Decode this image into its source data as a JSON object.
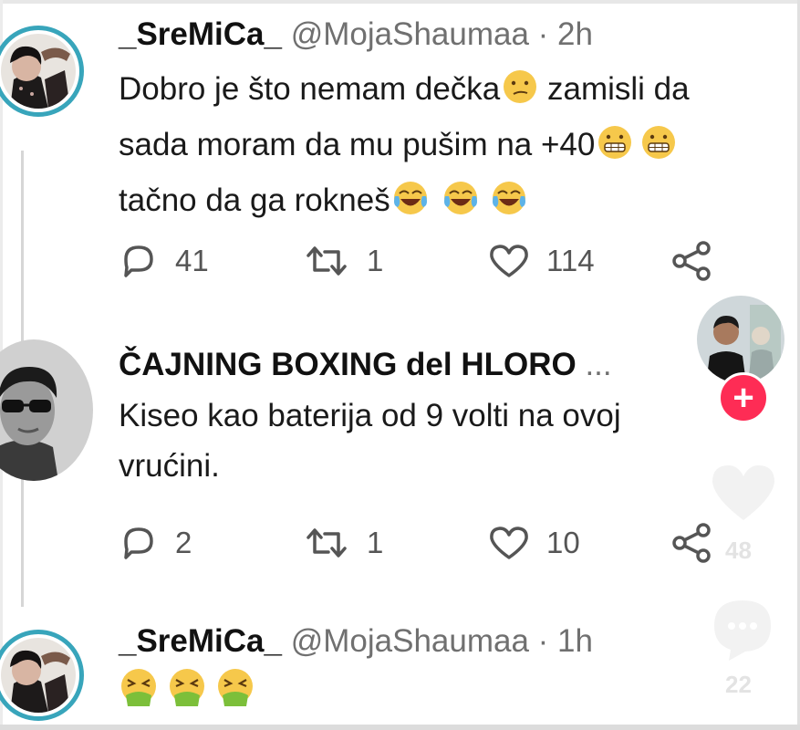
{
  "tweets": [
    {
      "name": "_SreMiCa_",
      "handle": "@MojaShaumaa",
      "time": "· 2h",
      "lines": [
        "Dobro je što nemam dečka",
        "zamisli da",
        "sada moram da mu pušim na +40",
        "tačno da ga rokneš"
      ],
      "replies": "41",
      "retweets": "1",
      "likes": "114"
    },
    {
      "name": "ČAJNING BOXING del HLORO",
      "more": "...",
      "lines": [
        "Kiseo kao baterija od 9 volti na ovoj",
        "vrućini."
      ],
      "replies": "2",
      "retweets": "1",
      "likes": "10"
    },
    {
      "name": "_SreMiCa_",
      "handle": "@MojaShaumaa",
      "time": "· 1h"
    }
  ],
  "overlay": {
    "plus": "+",
    "like_count": "48",
    "comment_count": "22"
  },
  "icons": [
    "reply-icon",
    "retweet-icon",
    "like-icon",
    "share-icon",
    "emoji-face"
  ]
}
